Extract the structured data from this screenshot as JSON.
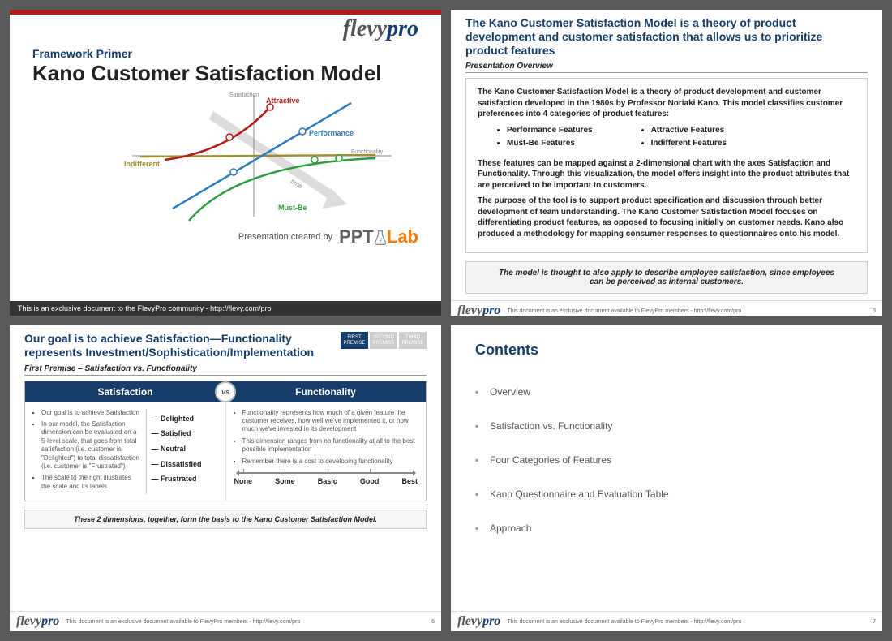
{
  "logo": {
    "part1": "flevy",
    "part2": "pro"
  },
  "slide1": {
    "subtitle": "Framework Primer",
    "title": "Kano Customer Satisfaction Model",
    "axis_y": "Satisfaction",
    "axis_x": "Functionality",
    "label_attractive": "Attractive",
    "label_performance": "Performance",
    "label_indifferent": "Indifferent",
    "label_mustbe": "Must-Be",
    "label_time": "time",
    "presented_by": "Presentation created by",
    "pptlab_1": "PPT",
    "pptlab_2": "Lab",
    "footer": "This is an exclusive document to the FlevyPro community - http://flevy.com/pro"
  },
  "slide2": {
    "title": "The Kano Customer Satisfaction Model is a theory of product development and customer satisfaction that allows us to prioritize product features",
    "overview_label": "Presentation Overview",
    "p1": "The Kano Customer Satisfaction Model is a theory of product development and customer satisfaction developed in the 1980s by Professor Noriaki Kano.  This model classifies customer preferences into 4 categories of product features:",
    "features_left": [
      "Performance Features",
      "Must-Be Features"
    ],
    "features_right": [
      "Attractive Features",
      "Indifferent Features"
    ],
    "p2": "These features can be mapped against a 2-dimensional chart with the axes Satisfaction and Functionality.  Through this visualization, the model offers insight into the product attributes that are perceived to be important to customers.",
    "p3": "The purpose of the tool is to support product specification and discussion through better development of team understanding.  The Kano Customer Satisfaction Model focuses on differentiating product features, as opposed to focusing initially on customer needs. Kano also produced a methodology for mapping consumer responses to questionnaires onto his model.",
    "callout": "The model is thought to also apply to describe employee satisfaction, since employees can be perceived as internal customers.",
    "footer": "This document is an exclusive document available to FlevyPro members - http://flevy.com/pro",
    "page": "3"
  },
  "slide3": {
    "title": "Our goal is to achieve Satisfaction—Functionality represents Investment/Sophistication/Implementation",
    "badges": [
      "FIRST PREMISE",
      "SECOND PREMISE",
      "THIRD PREMISE"
    ],
    "subtitle": "First Premise – Satisfaction vs. Functionality",
    "col_left": "Satisfaction",
    "col_right": "Functionality",
    "vs": "vs",
    "left_bullets": [
      "Our goal is to achieve Satisfaction",
      "In our model, the Satisfaction dimension can be evaluated on a 5-level scale, that goes from total satisfaction (i.e. customer is \"Delighted\") to total dissatisfaction (i.e. customer is \"Frustrated\")",
      "The scale to the right illustrates the scale and its labels"
    ],
    "scale": [
      "— Delighted",
      "— Satisfied",
      "— Neutral",
      "— Dissatisfied",
      "— Frustrated"
    ],
    "right_bullets": [
      "Functionality represents how much of a given feature the customer receives, how well we've implemented it, or how much we've invested in its development",
      "This dimension ranges from no functionality at all to the best possible implementation",
      "Remember there is a cost to developing functionality"
    ],
    "hscale": [
      "None",
      "Some",
      "Basic",
      "Good",
      "Best"
    ],
    "callout": "These 2 dimensions, together, form the basis to the Kano Customer Satisfaction Model.",
    "footer": "This document is an exclusive document available to FlevyPro members - http://flevy.com/pro",
    "page": "6"
  },
  "slide4": {
    "title": "Contents",
    "items": [
      "Overview",
      "Satisfaction vs. Functionality",
      "Four Categories of Features",
      "Kano Questionnaire and Evaluation Table",
      "Approach"
    ],
    "footer": "This document is an exclusive document available to FlevyPro members - http://flevy.com/pro",
    "page": "7"
  },
  "chart_data": {
    "type": "line",
    "title": "Kano Model Curves",
    "xlabel": "Functionality",
    "ylabel": "Satisfaction",
    "series": [
      {
        "name": "Attractive",
        "color": "#b31b1b",
        "shape": "concave-up"
      },
      {
        "name": "Performance",
        "color": "#2b7bbd",
        "shape": "linear"
      },
      {
        "name": "Indifferent",
        "color": "#a09030",
        "shape": "flat"
      },
      {
        "name": "Must-Be",
        "color": "#2e9e3e",
        "shape": "concave-down"
      }
    ],
    "annotations": [
      "time arrow diagonal"
    ]
  }
}
